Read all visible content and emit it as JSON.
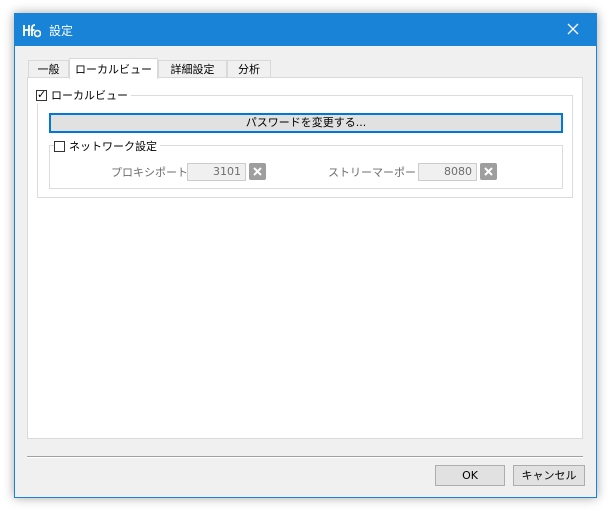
{
  "window": {
    "title": "設定",
    "close_icon": "close-icon",
    "app_icon": "hfs-app-icon",
    "accent": "#1883d7"
  },
  "tabs": [
    {
      "label": "一般",
      "active": false
    },
    {
      "label": "ローカルビュー",
      "active": true
    },
    {
      "label": "詳細設定",
      "active": false
    },
    {
      "label": "分析",
      "active": false
    }
  ],
  "local_view": {
    "checkbox_label": "ローカルビュー",
    "checked": true,
    "password_button": "パスワードを変更する...",
    "network": {
      "checkbox_label": "ネットワーク設定",
      "checked": false,
      "proxy_port_label": "プロキシポート:",
      "proxy_port_value": "3101",
      "stream_port_label": "ストリーマーポート:",
      "stream_port_value": "8080"
    }
  },
  "footer": {
    "ok_label": "OK",
    "cancel_label": "キャンセル"
  }
}
